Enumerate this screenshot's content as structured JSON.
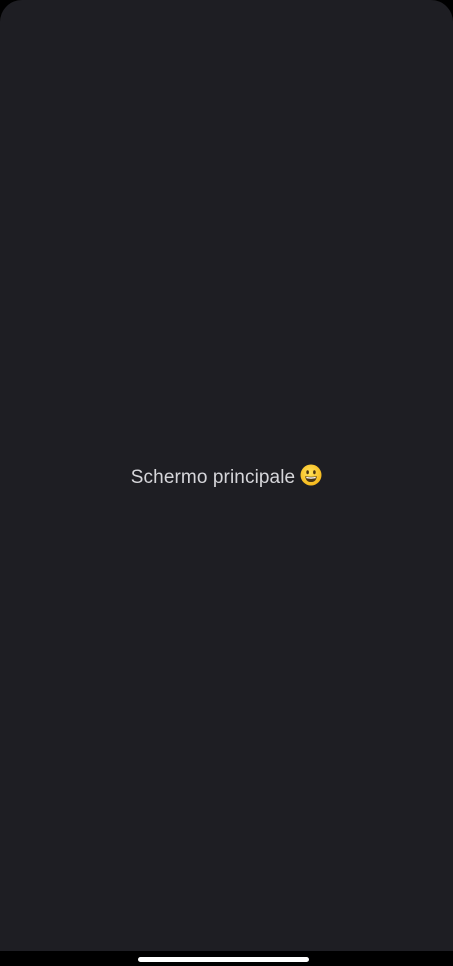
{
  "screen": {
    "message": "Schermo principale",
    "emoji_icon": "grinning-face-icon",
    "background": "#1e1e23",
    "text_color": "#d6d6da"
  },
  "system": {
    "home_indicator_color": "#ffffff"
  }
}
